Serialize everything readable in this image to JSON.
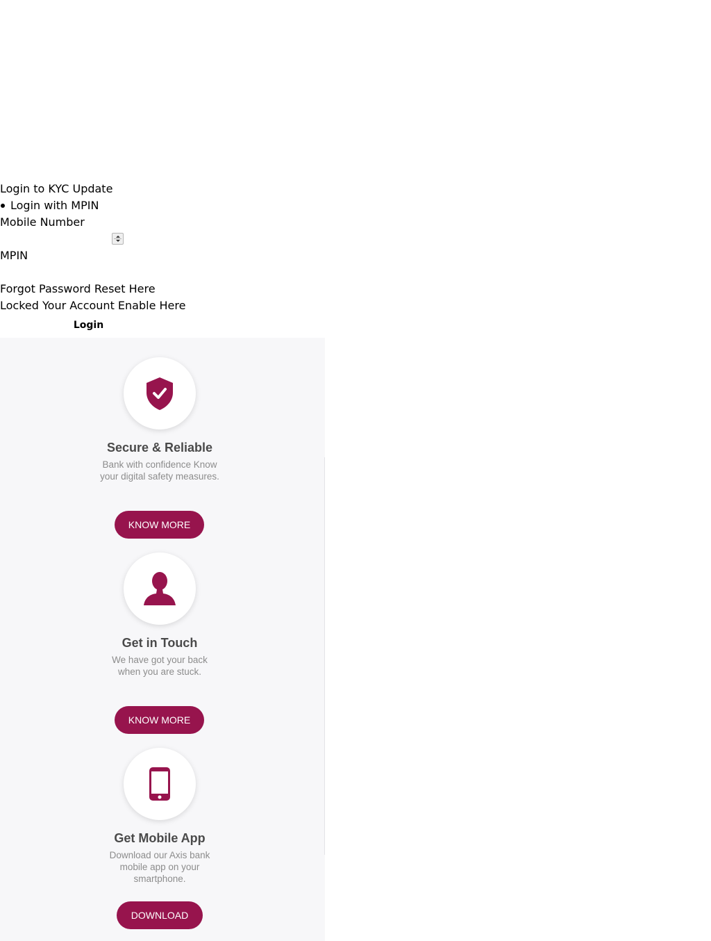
{
  "login": {
    "heading": "Login to KYC Update",
    "mode_option": "Login with MPIN",
    "mobile_label": "Mobile Number",
    "mobile_value": "",
    "mpin_label": "MPIN",
    "mpin_value": "",
    "forgot_text": "Forgot Password Reset Here",
    "locked_text": "Locked Your Account Enable Here",
    "submit_label": "Login"
  },
  "features": [
    {
      "icon": "shield-check-icon",
      "title": "Secure & Reliable",
      "description": "Bank with confidence Know your digital safety measures.",
      "button_label": "KNOW MORE"
    },
    {
      "icon": "person-icon",
      "title": "Get in Touch",
      "description": "We have got your back when you are stuck.",
      "button_label": "KNOW MORE"
    },
    {
      "icon": "mobile-phone-icon",
      "title": "Get Mobile App",
      "description": "Download our Axis bank mobile app on your smartphone.",
      "button_label": "DOWNLOAD"
    }
  ],
  "colors": {
    "brand": "#97144d",
    "panel_background": "#f7f7f9",
    "title_text": "#4a4a4a",
    "description_text": "#8c8c8c"
  }
}
